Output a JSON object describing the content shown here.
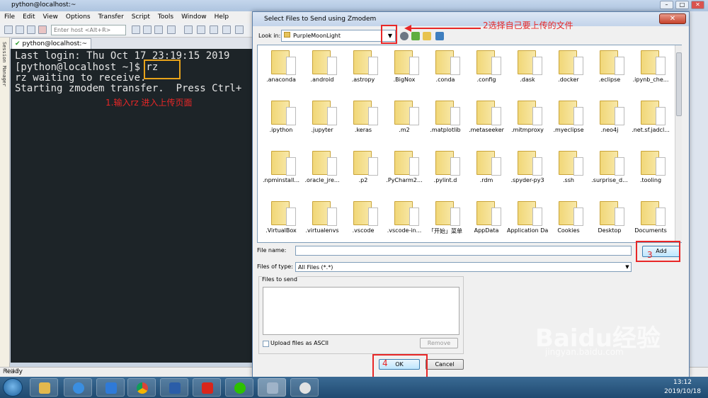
{
  "app": {
    "window_title": "python@localhost:~",
    "menu": [
      "File",
      "Edit",
      "View",
      "Options",
      "Transfer",
      "Script",
      "Tools",
      "Window",
      "Help"
    ],
    "host_placeholder": "Enter host <Alt+R>",
    "session_manager_label": "Session Manager",
    "tab_label": "python@localhost:~",
    "status": "Ready",
    "status_right": "NUM"
  },
  "terminal": {
    "lines": [
      "Last login: Thu Oct 17 23:19:15 2019",
      "[python@localhost ~]$ rz",
      "rz waiting to receive.",
      "Starting zmodem transfer.  Press Ctrl+"
    ]
  },
  "annotations": {
    "step1": "1.输入rz 进入上传页面",
    "step2": "2选择自己要上传的文件",
    "step3": "3",
    "step4": "4"
  },
  "dialog": {
    "title": "Select Files to Send using Zmodem",
    "close_glyph": "✕",
    "look_in_label": "Look in:",
    "look_in_value": "PurpleMoonLight",
    "file_name_label": "File name:",
    "file_name_value": "",
    "add_label": "Add",
    "files_of_type_label": "Files of type:",
    "files_of_type_value": "All Files (*.*)",
    "files_to_send_label": "Files to send",
    "upload_ascii_label": "Upload files as ASCII",
    "remove_label": "Remove",
    "ok_label": "OK",
    "cancel_label": "Cancel",
    "items": [
      ".anaconda",
      ".android",
      ".astropy",
      ".BigNox",
      ".conda",
      ".config",
      ".dask",
      ".docker",
      ".eclipse",
      ".ipynb_che...",
      ".ipython",
      ".jupyter",
      ".keras",
      ".m2",
      ".matplotlib",
      ".metaseeker",
      ".mitmproxy",
      ".myeclipse",
      ".neo4j",
      ".net.sf.jadcl...",
      ".npminstall...",
      ".oracle_jre...",
      ".p2",
      ".PyCharm2...",
      ".pylint.d",
      ".rdm",
      ".spyder-py3",
      ".ssh",
      ".surprise_d...",
      ".tooling",
      ".VirtualBox",
      ".virtualenvs",
      ".vscode",
      ".vscode-in...",
      "「开始」菜单",
      "AppData",
      "Application Data",
      "Cookies",
      "Desktop",
      "Documents"
    ]
  },
  "watermark": {
    "text": "Baidu经验",
    "sub": "jingyan.baidu.com"
  },
  "taskbar": {
    "time": "13:12",
    "date": "2019/10/18"
  },
  "colors": {
    "annotation": "#e82727",
    "highlight": "#e8a31a",
    "terminal_bg": "#1d2428"
  }
}
